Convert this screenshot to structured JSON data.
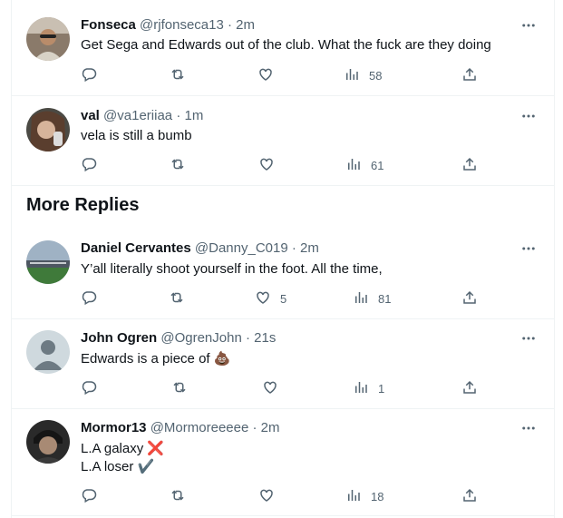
{
  "tweets_top": [
    {
      "name": "Fonseca",
      "handle": "@rjfonseca13",
      "time": "2m",
      "text": "Get Sega and Edwards out of the club. What the fuck are they doing",
      "views": "58",
      "avatar": "photo-fonseca"
    },
    {
      "name": "val",
      "handle": "@va1eriiaa",
      "time": "1m",
      "text": "vela is still a bumb",
      "views": "61",
      "avatar": "photo-val"
    }
  ],
  "section_title": "More Replies",
  "tweets_more": [
    {
      "name": "Daniel Cervantes",
      "handle": "@Danny_C019",
      "time": "2m",
      "text": "Y’all literally shoot yourself in the foot. All the time,",
      "likes": "5",
      "views": "81",
      "avatar": "photo-stadium"
    },
    {
      "name": "John Ogren",
      "handle": "@OgrenJohn",
      "time": "21s",
      "text": "Edwards is a piece of 💩",
      "views": "1",
      "avatar": "default-avatar"
    },
    {
      "name": "Mormor13",
      "handle": "@Mormoreeeee",
      "time": "2m",
      "text_line1": "L.A galaxy ❌",
      "text_line2": "L.A loser ✔️",
      "views": "18",
      "avatar": "photo-mormor"
    }
  ],
  "separator": "·",
  "icons": {
    "reply": "reply-icon",
    "retweet": "retweet-icon",
    "like": "heart-icon",
    "views": "views-icon",
    "share": "share-icon",
    "more": "more-icon"
  },
  "colors": {
    "text": "#0f1419",
    "secondary": "#536471",
    "border": "#eff3f4"
  }
}
